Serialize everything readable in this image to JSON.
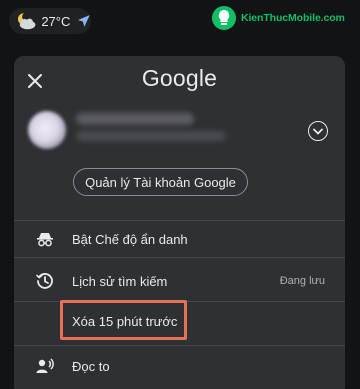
{
  "status_bar": {
    "weather": {
      "temperature": "27°C",
      "icon": "partly-cloudy-night-icon"
    },
    "location_icon": "navigation-arrow-icon"
  },
  "watermark": {
    "text": "KienThucMobile.com"
  },
  "account_menu": {
    "close_icon": "close-icon",
    "brand": "Google",
    "expand_icon": "chevron-down-icon",
    "manage_account_label": "Quản lý Tài khoản Google",
    "items": [
      {
        "label": "Bật Chế độ ẩn danh",
        "icon": "incognito-icon",
        "meta": ""
      },
      {
        "label": "Lịch sử tìm kiếm",
        "icon": "history-icon",
        "meta": "Đang lưu"
      },
      {
        "label": "Xóa 15 phút trước",
        "icon": "",
        "meta": ""
      },
      {
        "label": "Đọc to",
        "icon": "read-aloud-icon",
        "meta": ""
      }
    ]
  },
  "colors": {
    "background": "#121315",
    "panel": "#2f3033",
    "highlight_border": "#e8705a",
    "watermark": "#0fbf66"
  }
}
